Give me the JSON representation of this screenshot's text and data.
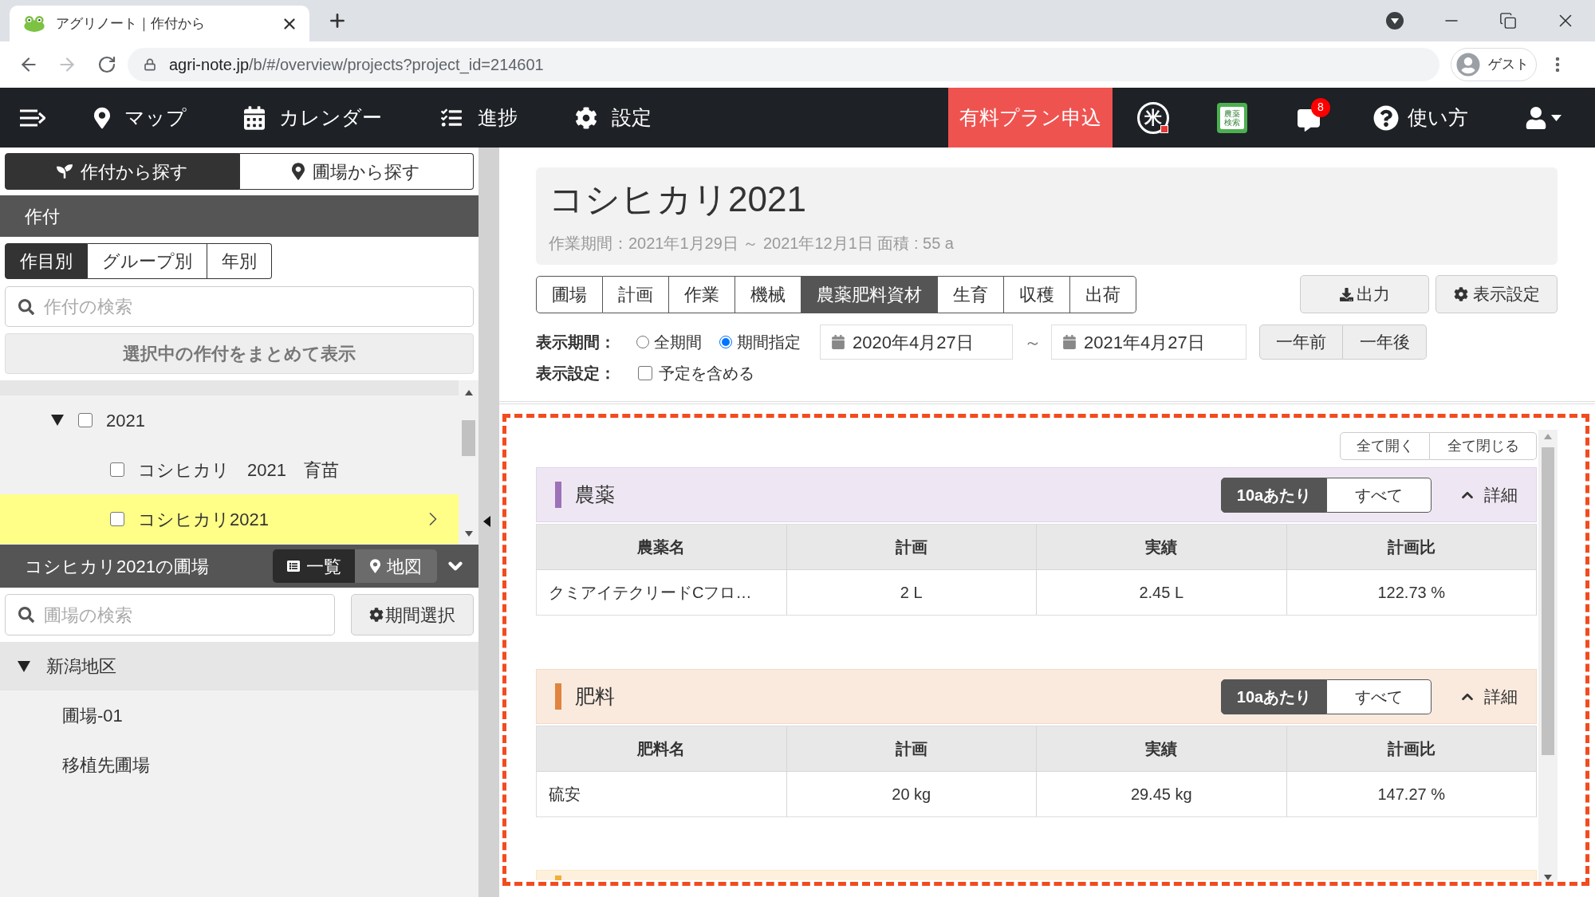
{
  "browser": {
    "tab_title": "アグリノート｜作付から",
    "url_host": "agri-note.jp",
    "url_path": "/b/#/overview/projects?project_id=214601",
    "forward_disabled": true,
    "profile": "ゲスト"
  },
  "navbar": {
    "items": [
      {
        "label": "マップ"
      },
      {
        "label": "カレンダー"
      },
      {
        "label": "進捗"
      },
      {
        "label": "設定"
      }
    ],
    "plan_button": "有料プラン申込",
    "rice_glyph": "米",
    "book_label": [
      "農薬",
      "検索"
    ],
    "notification_count": "8",
    "help_label": "使い方"
  },
  "sidebar": {
    "search_modes": [
      {
        "label": "作付から探す",
        "selected": true
      },
      {
        "label": "圃場から探す",
        "selected": false
      }
    ],
    "section_title": "作付",
    "group_tabs": [
      {
        "label": "作目別",
        "selected": true
      },
      {
        "label": "グループ別",
        "selected": false
      },
      {
        "label": "年別",
        "selected": false
      }
    ],
    "search": {
      "placeholder": "作付の検索"
    },
    "show_selected_button": "選択中の作付をまとめて表示",
    "crops": [
      {
        "label": "2021",
        "expanded": true,
        "checked": false,
        "selected": false,
        "children": [
          {
            "label": "コシヒカリ　2021　育苗",
            "checked": false,
            "selected": false
          },
          {
            "label": "コシヒカリ2021",
            "checked": false,
            "selected": true
          }
        ]
      }
    ],
    "fields_panel": {
      "title": "コシヒカリ2021の圃場",
      "view_tabs": [
        {
          "label": "一覧",
          "selected": true
        },
        {
          "label": "地図",
          "selected": false
        }
      ],
      "search": {
        "placeholder": "圃場の検索"
      },
      "period_button": "期間選択",
      "areas": [
        {
          "label": "新潟地区",
          "expanded": true,
          "children": [
            {
              "label": "圃場-01"
            },
            {
              "label": "移植先圃場"
            }
          ]
        }
      ]
    }
  },
  "project": {
    "title": "コシヒカリ2021",
    "subtitle": "作業期間：2021年1月29日 ～ 2021年12月1日 面積 : 55 a",
    "tabs": [
      {
        "label": "圃場",
        "selected": false
      },
      {
        "label": "計画",
        "selected": false
      },
      {
        "label": "作業",
        "selected": false
      },
      {
        "label": "機械",
        "selected": false
      },
      {
        "label": "農薬肥料資材",
        "selected": true
      },
      {
        "label": "生育",
        "selected": false
      },
      {
        "label": "収穫",
        "selected": false
      },
      {
        "label": "出荷",
        "selected": false
      }
    ],
    "export_button": "出力",
    "display_settings_button": "表示設定",
    "filters": {
      "period_label": "表示期間：",
      "period_options": [
        {
          "label": "全期間",
          "selected": false
        },
        {
          "label": "期間指定",
          "selected": true
        }
      ],
      "date_from": "2020年4月27日",
      "range_separator": "～",
      "date_to": "2021年4月27日",
      "prev_year_button": "一年前",
      "next_year_button": "一年後",
      "settings_label": "表示設定：",
      "include_planned": {
        "label": "予定を含める",
        "checked": false
      }
    },
    "expand_all_button": "全て開く",
    "collapse_all_button": "全て閉じる",
    "sections": [
      {
        "title": "農薬",
        "color": "#9d72b8",
        "unit_options": [
          {
            "label": "10aあたり",
            "selected": true
          },
          {
            "label": "すべて",
            "selected": false
          }
        ],
        "details_label": "詳細",
        "expanded": true,
        "columns": [
          "農薬名",
          "計画",
          "実績",
          "計画比"
        ],
        "rows": [
          [
            "クミアイテクリードCフロ…",
            "2 L",
            "2.45 L",
            "122.73 %"
          ]
        ]
      },
      {
        "title": "肥料",
        "color": "#e0843f",
        "unit_options": [
          {
            "label": "10aあたり",
            "selected": true
          },
          {
            "label": "すべて",
            "selected": false
          }
        ],
        "details_label": "詳細",
        "expanded": true,
        "columns": [
          "肥料名",
          "計画",
          "実績",
          "計画比"
        ],
        "rows": [
          [
            "硫安",
            "20 kg",
            "29.45 kg",
            "147.27 %"
          ]
        ]
      },
      {
        "color": "#f2ae35"
      }
    ]
  }
}
